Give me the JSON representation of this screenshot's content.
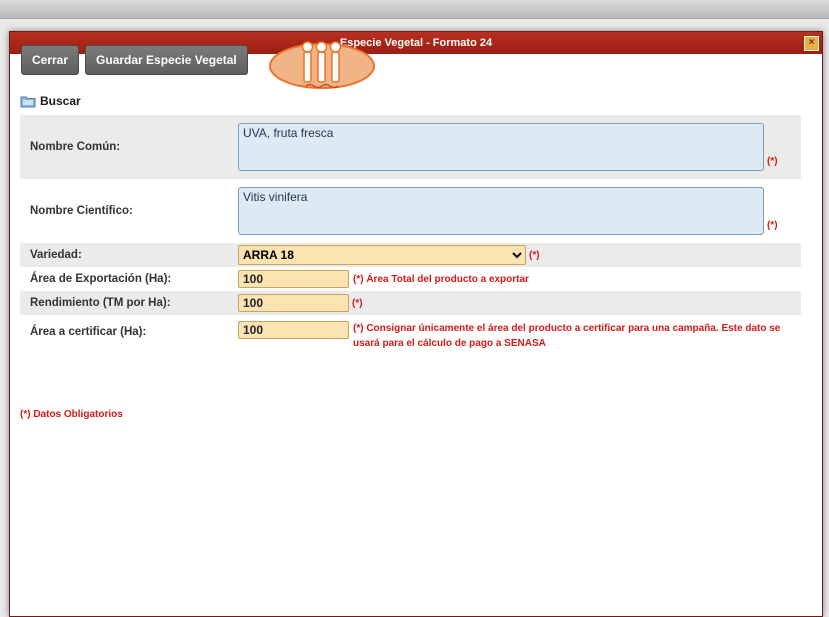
{
  "window": {
    "title": "Especie Vegetal - Formato 24",
    "close_glyph": "×"
  },
  "toolbar": {
    "close_label": "Cerrar",
    "save_label": "Guardar Especie Vegetal"
  },
  "search": {
    "label": "Buscar",
    "icon": "search-folder-icon"
  },
  "form": {
    "nombre_comun": {
      "label": "Nombre Común:",
      "value": "UVA, fruta fresca",
      "required": "(*)"
    },
    "nombre_cientifico": {
      "label": "Nombre Científico:",
      "value": "Vitis vinifera",
      "required": "(*)"
    },
    "variedad": {
      "label": "Variedad:",
      "value": "ARRA 18",
      "required": "(*)"
    },
    "area_exportacion": {
      "label": "Área de Exportación (Ha):",
      "value": "100",
      "note": "(*) Área Total del producto a exportar"
    },
    "rendimiento": {
      "label": "Rendimiento (TM por Ha):",
      "value": "100",
      "required": "(*)"
    },
    "area_certificar": {
      "label": "Área a certificar (Ha):",
      "value": "100",
      "note": "(*) Consignar únicamente el área del producto a certificar para una campaña. Este dato se usará para el cálculo de pago a SENASA"
    }
  },
  "footnote": "(*) Datos Obligatorios",
  "colors": {
    "titlebar": "#a8261a",
    "required_text": "#d51a1a",
    "input_bg": "#fbe3b2",
    "textarea_bg": "#dde9f3",
    "button_bg": "#6b6b6b"
  }
}
